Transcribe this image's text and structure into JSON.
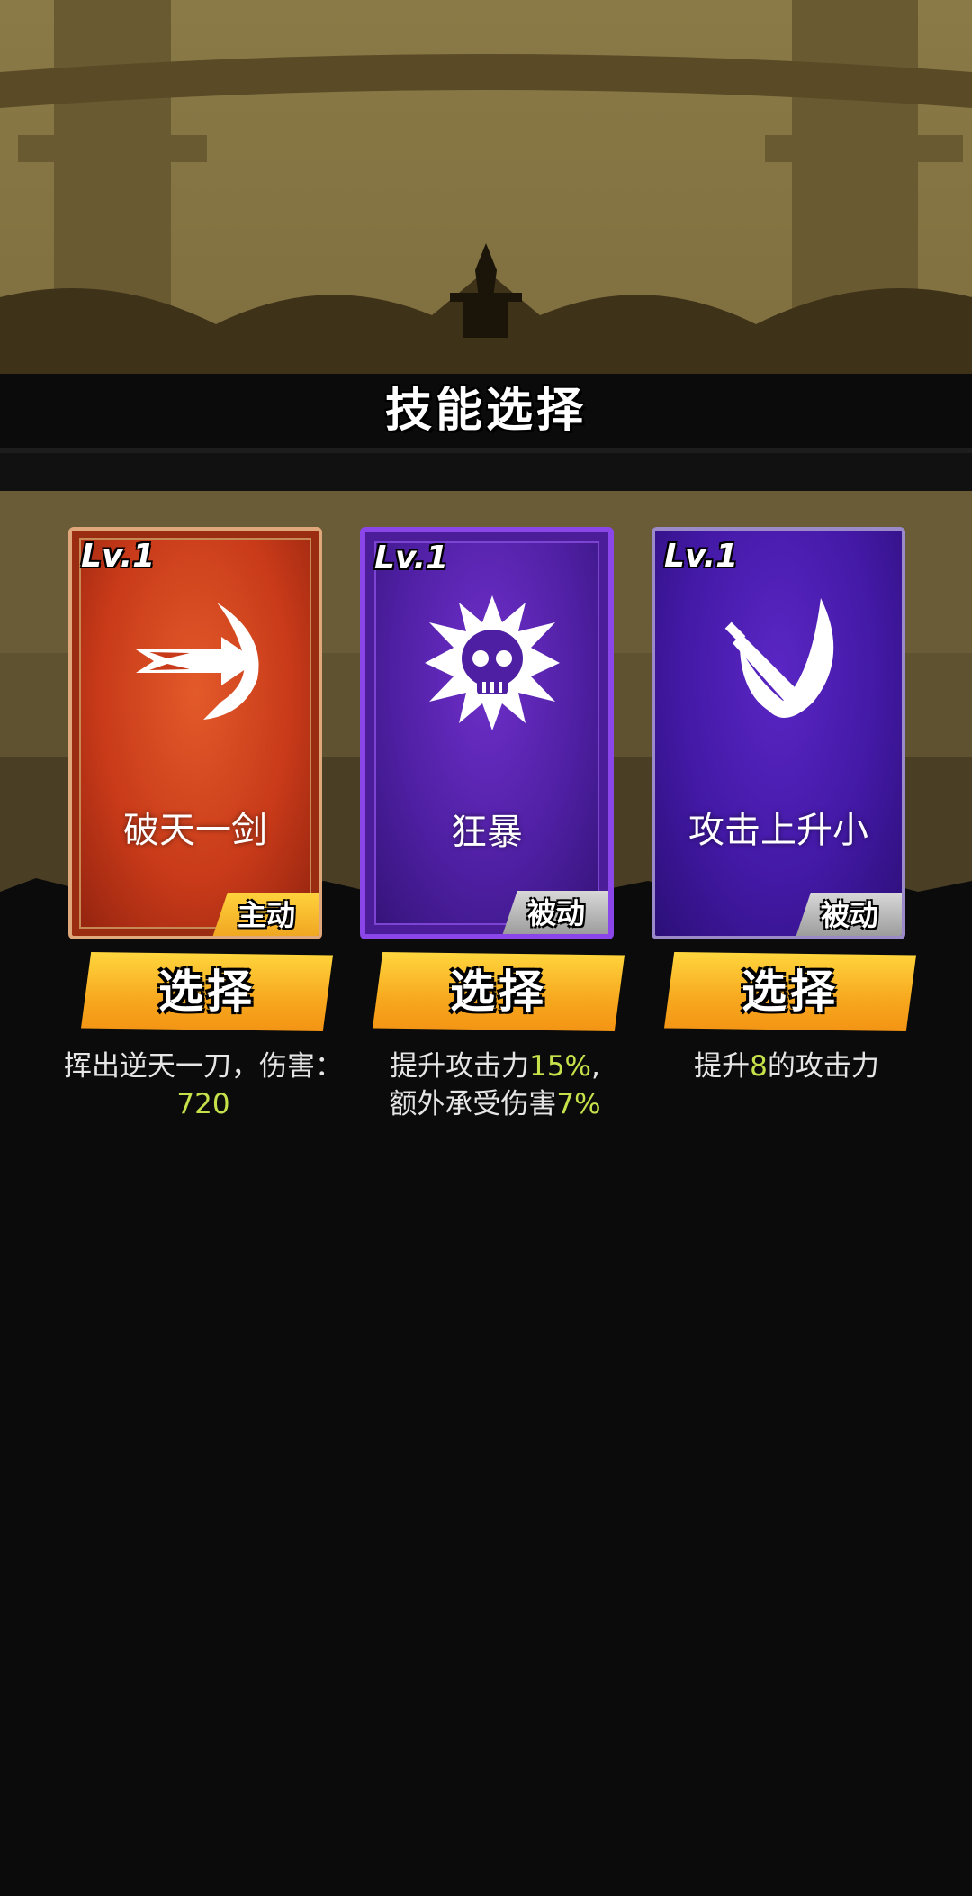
{
  "title": "技能选择",
  "colors": {
    "active_badge": "#f5b52a",
    "passive_badge": "#b8b8b8",
    "highlight": "#c6e24a",
    "button": "#f7a81e"
  },
  "cards": [
    {
      "level": "Lv.1",
      "name": "破天一剑",
      "type": "主动",
      "icon": "arrow-strike-icon",
      "button_label": "选择",
      "desc_parts": [
        "挥出逆天一刀，伤害：",
        "720"
      ]
    },
    {
      "level": "Lv.1",
      "name": "狂暴",
      "type": "被动",
      "icon": "skull-burst-icon",
      "button_label": "选择",
      "desc_parts": [
        "提升攻击力",
        "15%",
        ",",
        "额外承受伤害",
        "7%"
      ]
    },
    {
      "level": "Lv.1",
      "name": "攻击上升小",
      "type": "被动",
      "icon": "blade-slash-icon",
      "button_label": "选择",
      "desc_parts": [
        "提升",
        "8",
        "的攻击力"
      ]
    }
  ]
}
